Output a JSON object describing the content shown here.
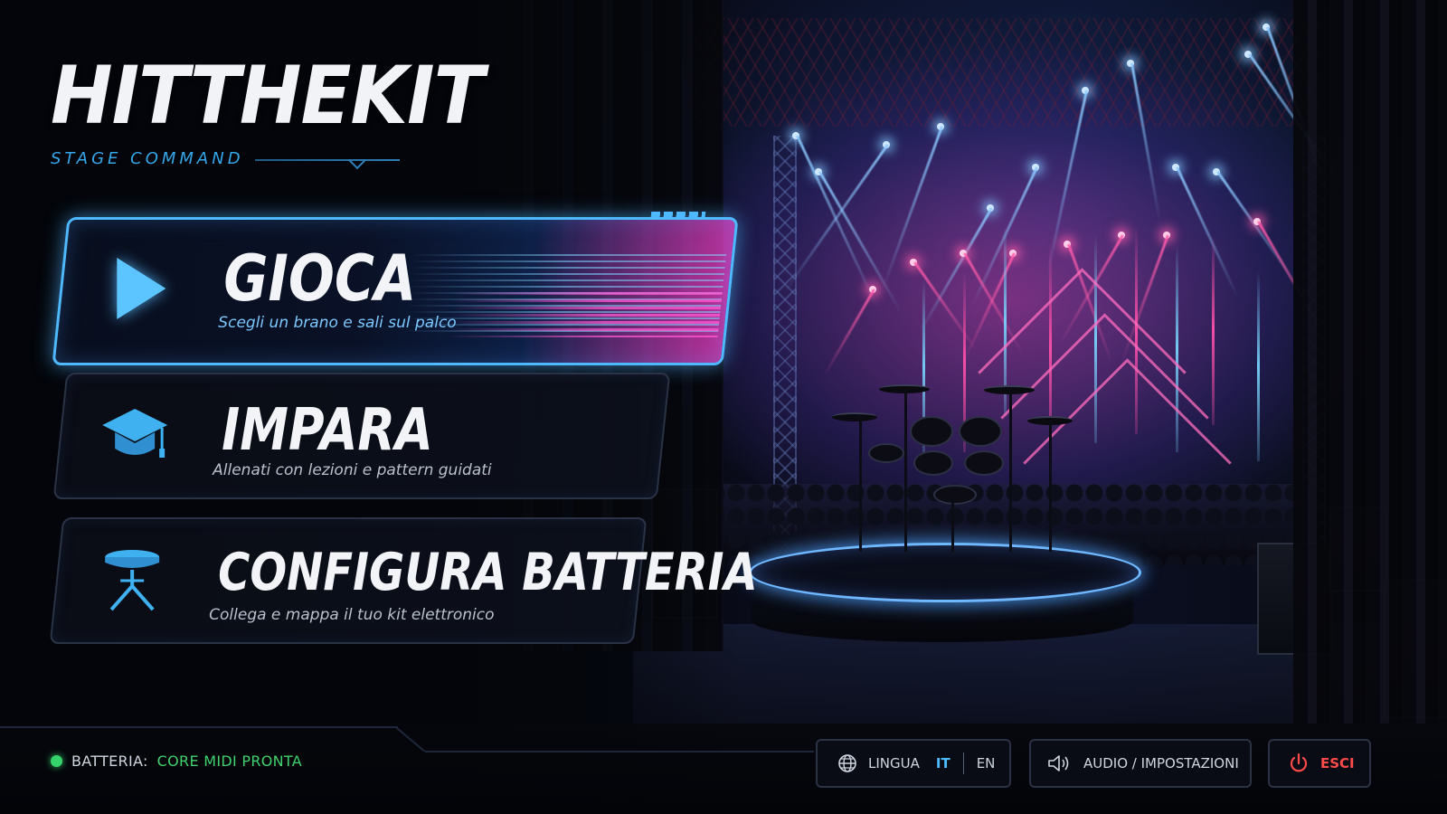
{
  "app": {
    "title": "HITTHEKIT",
    "subtitle": "STAGE COMMAND"
  },
  "menu": {
    "items": [
      {
        "id": "play",
        "label": "GIOCA",
        "description": "Scegli un brano e sali sul palco",
        "icon": "play-icon",
        "selected": true
      },
      {
        "id": "learn",
        "label": "IMPARA",
        "description": "Allenati con lezioni e pattern guidati",
        "icon": "graduation-cap-icon",
        "selected": false
      },
      {
        "id": "config",
        "label": "CONFIGURA BATTERIA",
        "description": "Collega e mappa il tuo kit elettronico",
        "icon": "drum-throne-icon",
        "selected": false
      }
    ]
  },
  "status": {
    "label": "BATTERIA:",
    "value": "CORE MIDI PRONTA",
    "color": "#3fd26e"
  },
  "footer": {
    "language": {
      "icon": "globe-icon",
      "label": "LINGUA",
      "options": [
        "IT",
        "EN"
      ],
      "selected": "IT"
    },
    "audio": {
      "icon": "speaker-icon",
      "label": "AUDIO / IMPOSTAZIONI"
    },
    "exit": {
      "icon": "power-icon",
      "label": "ESCI",
      "color": "#ff4a4a"
    }
  },
  "colors": {
    "accent": "#4fb9ff",
    "highlight": "#e63cbe",
    "background": "#05070d"
  }
}
